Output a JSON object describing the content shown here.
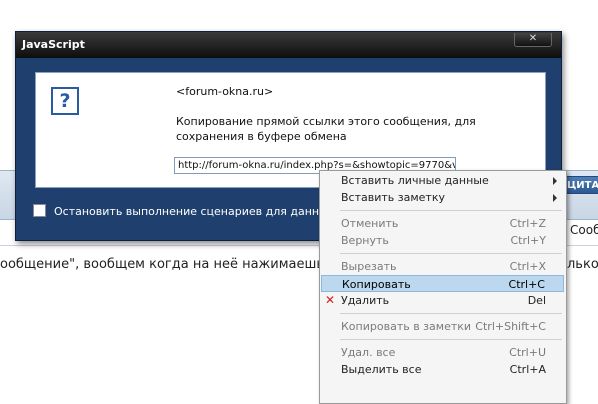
{
  "background": {
    "quote_button": "ЦИТАТ",
    "right_text": "Сооб",
    "body_text": "ообщение\", вообщем когда на неё нажимаешь,",
    "body_text_right": "лько"
  },
  "dialog": {
    "title": "JavaScript",
    "close_label": "✕",
    "site": "<forum-okna.ru>",
    "message": "Копирование прямой ссылки этого сообщения, для сохранения в буфере обмена",
    "url_value": "http://forum-okna.ru/index.php?s=&showtopic=9770&vie",
    "stop_scripts_label": "Остановить выполнение сценариев для данной стр",
    "icon": "question-icon"
  },
  "context_menu": {
    "items": [
      {
        "label": "Вставить личные данные",
        "shortcut": "",
        "submenu": true,
        "disabled": false
      },
      {
        "label": "Вставить заметку",
        "shortcut": "",
        "submenu": true,
        "disabled": false
      },
      {
        "label": "Отменить",
        "shortcut": "Ctrl+Z",
        "disabled": true
      },
      {
        "label": "Вернуть",
        "shortcut": "Ctrl+Y",
        "disabled": true
      },
      {
        "label": "Вырезать",
        "shortcut": "Ctrl+X",
        "disabled": true
      },
      {
        "label": "Копировать",
        "shortcut": "Ctrl+C",
        "highlighted": true
      },
      {
        "label": "Удалить",
        "shortcut": "Del",
        "disabled": false,
        "icon": "delete-x-icon"
      },
      {
        "label": "Копировать в заметки",
        "shortcut": "Ctrl+Shift+C",
        "disabled": true
      },
      {
        "label": "Удал. все",
        "shortcut": "Ctrl+U",
        "disabled": true
      },
      {
        "label": "Выделить все",
        "shortcut": "Ctrl+A",
        "disabled": false
      }
    ]
  },
  "colors": {
    "dialog_frame": "#1f3f6e",
    "menu_highlight": "#bcd8ef"
  }
}
